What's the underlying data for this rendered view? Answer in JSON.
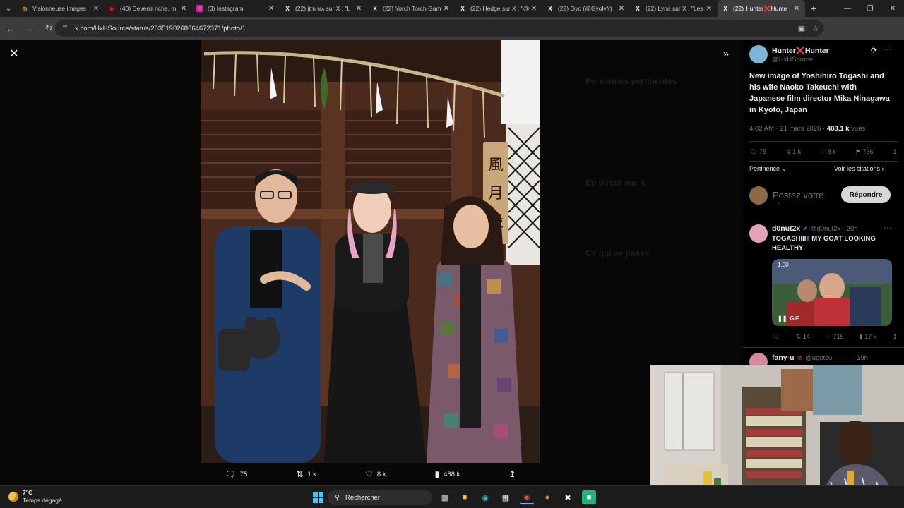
{
  "tabs": [
    {
      "title": "Visionneuse images",
      "fav_color": "#e8b04b",
      "fav_glyph": "◎"
    },
    {
      "title": "(40) Devenir riche, m",
      "fav_color": "#ff0000",
      "fav_glyph": "▶"
    },
    {
      "title": "(3) Instagram",
      "fav_color": "#d6249f",
      "fav_glyph": "○"
    },
    {
      "title": "(22) jtm ᴍᴀ sur X : \"L",
      "fav_color": "#ffffff",
      "fav_glyph": "X"
    },
    {
      "title": "(22) Yorch Torch Gam",
      "fav_color": "#ffffff",
      "fav_glyph": "X"
    },
    {
      "title": "(22) Hedge sur X : \"@",
      "fav_color": "#ffffff",
      "fav_glyph": "X"
    },
    {
      "title": "(22) Gyo (@Gyolvfr)",
      "fav_color": "#ffffff",
      "fav_glyph": "X"
    },
    {
      "title": "(22) Lyna sur X : \"Les",
      "fav_color": "#ffffff",
      "fav_glyph": "X"
    },
    {
      "title": "(22) Hunter❌Hunte",
      "fav_color": "#ffffff",
      "fav_glyph": "X",
      "active": true
    }
  ],
  "address": {
    "url": "x.com/HxHSource/status/2035190268664672371/photo/1"
  },
  "page": {
    "close_label": "✕",
    "expand_label": "»",
    "photo_actions": {
      "replies": "75",
      "reposts": "1 k",
      "likes": "8 k",
      "views": "488 k"
    }
  },
  "background_ghost": {
    "related_title": "Personnes pertinentes",
    "live_title": "En direct sur X",
    "happening_title": "Ce qui se passe"
  },
  "tweet": {
    "author_name": "Hunter❌Hunter",
    "author_handle": "@HxHSource",
    "text_lines": [
      "New image of Yoshihiro Togashi and",
      "his wife Naoko Takeuchi with",
      "Japanese film director Mika Ninagawa",
      "in Kyoto, Japan"
    ],
    "time": "4:02 AM · 21 mars 2026 · ",
    "views_count": "488,1 k",
    "views_label": " vues",
    "stats": {
      "replies": "75",
      "reposts": "1 k",
      "likes": "8 k",
      "bookmarks": "736"
    },
    "sort_label": "Pertinence",
    "quotes_link": "Voir les citations"
  },
  "reply_box": {
    "placeholder": "Postez votre réponse",
    "button": "Répondre"
  },
  "replies": [
    {
      "name": "d0nut2x",
      "handle": "@d0nut2x · 20h",
      "text_lines": [
        "TOGASHIIIII MY GOAT LOOKING",
        "HEALTHY"
      ],
      "gif_label": "GIF",
      "gif_time": "1.00",
      "stats": {
        "replies": "",
        "reposts": "14",
        "likes": "715",
        "views": "17 k"
      }
    },
    {
      "name": "fany-u",
      "handle": "@ugetsu_____ · 19h"
    }
  ],
  "taskbar": {
    "temp": "7°C",
    "weather": "Temps dégagé",
    "search_label": "Rechercher"
  },
  "colors": {
    "x_blue": "#1d9bf0",
    "bg": "#000000",
    "muted": "#71767b"
  }
}
